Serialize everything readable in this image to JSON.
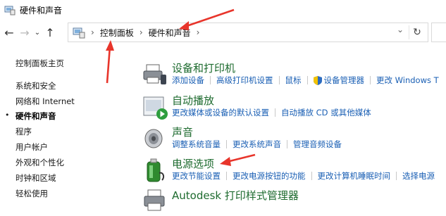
{
  "window": {
    "title": "硬件和声音"
  },
  "nav": {
    "back": "←",
    "forward": "→",
    "dropdown": "⌄",
    "up": "↑",
    "addr_dropdown": "⌄",
    "refresh": "↻"
  },
  "breadcrumb": [
    "控制面板",
    "硬件和声音"
  ],
  "breadcrumb_sep": "›",
  "sidebar": {
    "items": [
      {
        "label": "控制面板主页"
      },
      {
        "label": "系统和安全"
      },
      {
        "label": "网络和 Internet"
      },
      {
        "label": "硬件和声音",
        "active": true
      },
      {
        "label": "程序"
      },
      {
        "label": "用户帐户"
      },
      {
        "label": "外观和个性化"
      },
      {
        "label": "时钟和区域"
      },
      {
        "label": "轻松使用"
      }
    ],
    "bullet": "•"
  },
  "sections": [
    {
      "title": "设备和打印机",
      "icon": "printer-icon",
      "links": [
        "添加设备",
        "高级打印机设置",
        "鼠标",
        "设备管理器",
        "更改 Windows T"
      ]
    },
    {
      "title": "自动播放",
      "icon": "autoplay-icon",
      "links": [
        "更改媒体或设备的默认设置",
        "自动播放 CD 或其他媒体"
      ]
    },
    {
      "title": "声音",
      "icon": "speaker-icon",
      "links": [
        "调整系统音量",
        "更改系统声音",
        "管理音频设备"
      ]
    },
    {
      "title": "电源选项",
      "icon": "battery-icon",
      "links": [
        "更改节能设置",
        "更改电源按钮的功能",
        "更改计算机睡眠时间",
        "选择电源"
      ]
    },
    {
      "title": "Autodesk 打印样式管理器",
      "icon": "print-style-icon",
      "links": []
    }
  ],
  "colors": {
    "accent_link": "#1a5fb4",
    "section_title": "#1e6b2f",
    "annotation_arrow": "#e8352b"
  }
}
